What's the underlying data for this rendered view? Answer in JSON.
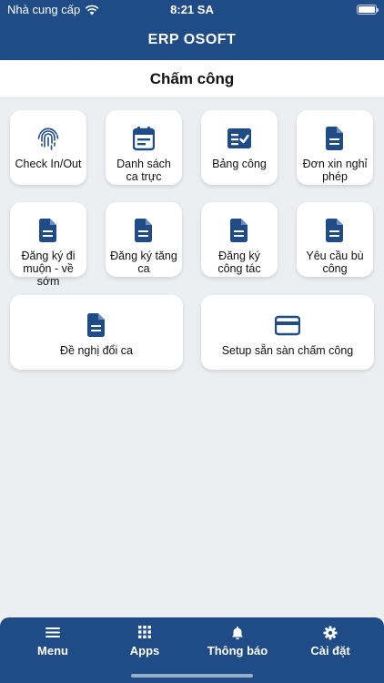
{
  "status_bar": {
    "carrier": "Nhà cung cấp",
    "time": "8:21 SA"
  },
  "app": {
    "title": "ERP OSOFT"
  },
  "page": {
    "title": "Chấm công"
  },
  "tiles": [
    {
      "label": "Check In/Out",
      "icon": "fingerprint-icon"
    },
    {
      "label": "Danh sách ca trực",
      "icon": "calendar-icon"
    },
    {
      "label": "Bảng công",
      "icon": "checklist-icon"
    },
    {
      "label": "Đơn xin nghỉ phép",
      "icon": "document-icon"
    },
    {
      "label": "Đăng ký đi muộn - về sớm",
      "icon": "document-icon"
    },
    {
      "label": "Đăng ký tăng ca",
      "icon": "document-icon"
    },
    {
      "label": "Đăng ký công tác",
      "icon": "document-icon"
    },
    {
      "label": "Yêu cầu bù công",
      "icon": "document-icon"
    },
    {
      "label": "Đề nghị đổi ca",
      "icon": "document-icon"
    },
    {
      "label": "Setup sẵn sàn chấm công",
      "icon": "card-icon"
    }
  ],
  "bottom_nav": [
    {
      "label": "Menu",
      "icon": "hamburger-icon"
    },
    {
      "label": "Apps",
      "icon": "grid-icon"
    },
    {
      "label": "Thông báo",
      "icon": "bell-icon"
    },
    {
      "label": "Cài đặt",
      "icon": "gear-icon"
    }
  ],
  "colors": {
    "primary": "#1f4b86",
    "background": "#eceef1",
    "tile": "#ffffff"
  }
}
